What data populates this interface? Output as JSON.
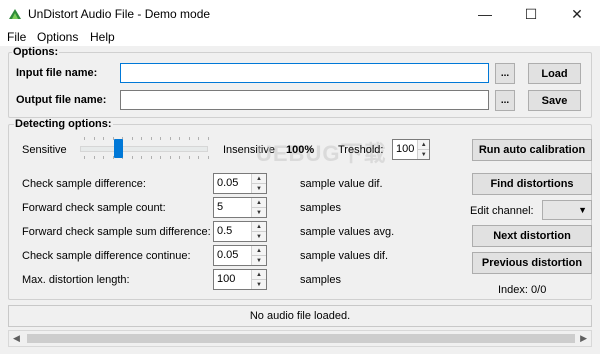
{
  "window": {
    "title": "UnDistort Audio File - Demo mode",
    "minimize": "—",
    "maximize": "☐",
    "close": "✕"
  },
  "menu": [
    "File",
    "Options",
    "Help"
  ],
  "options": {
    "section_title": "Options:",
    "input_label": "Input file name:",
    "input_value": "",
    "output_label": "Output file name:",
    "output_value": "",
    "browse_label": "...",
    "load_label": "Load",
    "save_label": "Save"
  },
  "detecting": {
    "section_title": "Detecting options:",
    "sensitive_label": "Sensitive",
    "insensitive_label": "Insensitive",
    "percent_display": "100%",
    "threshold_label": "Treshold:",
    "threshold_value": "100",
    "slider_level_fraction": 0.3,
    "params": [
      {
        "label": "Check sample difference:",
        "value": "0.05",
        "unit": "sample value dif."
      },
      {
        "label": "Forward check sample count:",
        "value": "5",
        "unit": "samples"
      },
      {
        "label": "Forward check sample sum difference:",
        "value": "0.5",
        "unit": "sample values avg."
      },
      {
        "label": "Check sample difference continue:",
        "value": "0.05",
        "unit": "sample values dif."
      },
      {
        "label": "Max. distortion length:",
        "value": "100",
        "unit": "samples"
      }
    ]
  },
  "side": {
    "run_auto_calibration": "Run auto calibration",
    "find_distortions": "Find distortions",
    "edit_channel_label": "Edit channel:",
    "edit_channel_value": "",
    "next_distortion": "Next distortion",
    "previous_distortion": "Previous distortion",
    "index": "Index: 0/0"
  },
  "status": {
    "text": "No audio file loaded."
  },
  "watermark": "UEBUG下载",
  "colors": {
    "accent": "#0078d7",
    "background": "#f0f0f0"
  }
}
